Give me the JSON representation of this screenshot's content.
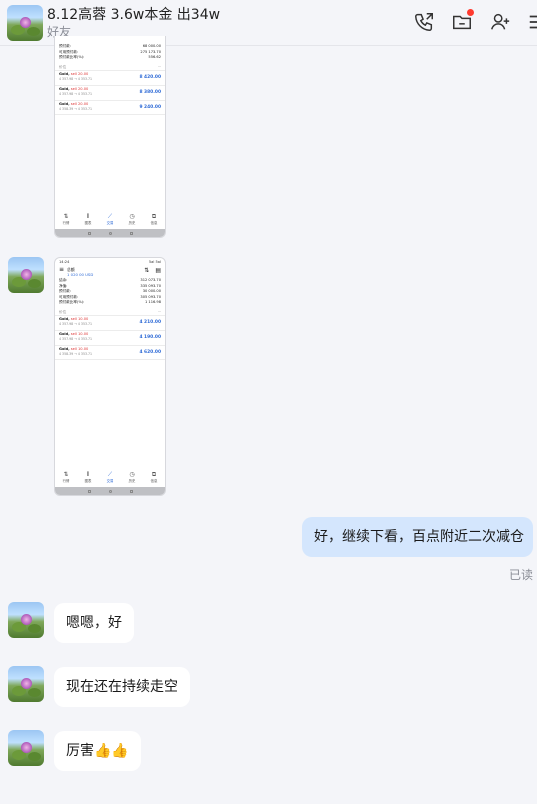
{
  "header": {
    "title": "8.12高蓉 3.6w本金 出34w",
    "subtitle": "好友",
    "icons": [
      "phone-call-icon",
      "folder-icon",
      "add-friend-icon",
      "more-menu-icon"
    ]
  },
  "shot1": {
    "summary": [
      {
        "label": "预付款:",
        "value": "68 000.00"
      },
      {
        "label": "可用预付款:",
        "value": "275 173.70"
      },
      {
        "label": "预付款比率(%):",
        "value": "556.62"
      }
    ],
    "section": "价位",
    "positions": [
      {
        "name": "Gold,",
        "side": "sell 20.00",
        "range": "4 357.98 → 4 353.71",
        "profit": "8 420.00"
      },
      {
        "name": "Gold,",
        "side": "sell 20.00",
        "range": "4 357.98 → 4 353.71",
        "profit": "8 380.00"
      },
      {
        "name": "Gold,",
        "side": "sell 20.00",
        "range": "4 358.39 → 4 353.71",
        "profit": "9 240.00"
      }
    ],
    "nav": [
      "行情",
      "图表",
      "交易",
      "历史",
      "信息"
    ]
  },
  "shot2": {
    "time": "14:24",
    "signal": "5al 5al",
    "account_label": "总额",
    "account_value": "1 020 00 USD",
    "summary": [
      {
        "label": "结余:",
        "value": "312 073.70"
      },
      {
        "label": "净值:",
        "value": "335 093.70"
      },
      {
        "label": "预付款:",
        "value": "30 000.00"
      },
      {
        "label": "可用预付款:",
        "value": "305 093.70"
      },
      {
        "label": "预付款比率(%):",
        "value": "1 116.98"
      }
    ],
    "section": "价位",
    "positions": [
      {
        "name": "Gold,",
        "side": "sell 10.00",
        "range": "4 357.98 → 4 353.71",
        "profit": "4 210.00"
      },
      {
        "name": "Gold,",
        "side": "sell 10.00",
        "range": "4 357.98 → 4 353.71",
        "profit": "4 190.00"
      },
      {
        "name": "Gold,",
        "side": "sell 10.00",
        "range": "4 358.39 → 4 353.71",
        "profit": "4 620.00"
      }
    ],
    "nav": [
      "行情",
      "图表",
      "交易",
      "历史",
      "信息"
    ]
  },
  "messages": {
    "mine1": "好，继续下看，百点附近二次减仓",
    "read_status": "已读",
    "reply1": "嗯嗯，好",
    "reply2": "现在还在持续走空",
    "reply3": "厉害👍👍"
  },
  "colors": {
    "background": "#f4f5f9",
    "my_bubble": "#d4e6fd",
    "their_bubble": "#ffffff",
    "unread_dot": "#ff3b30",
    "profit_blue": "#2f6bd6"
  }
}
